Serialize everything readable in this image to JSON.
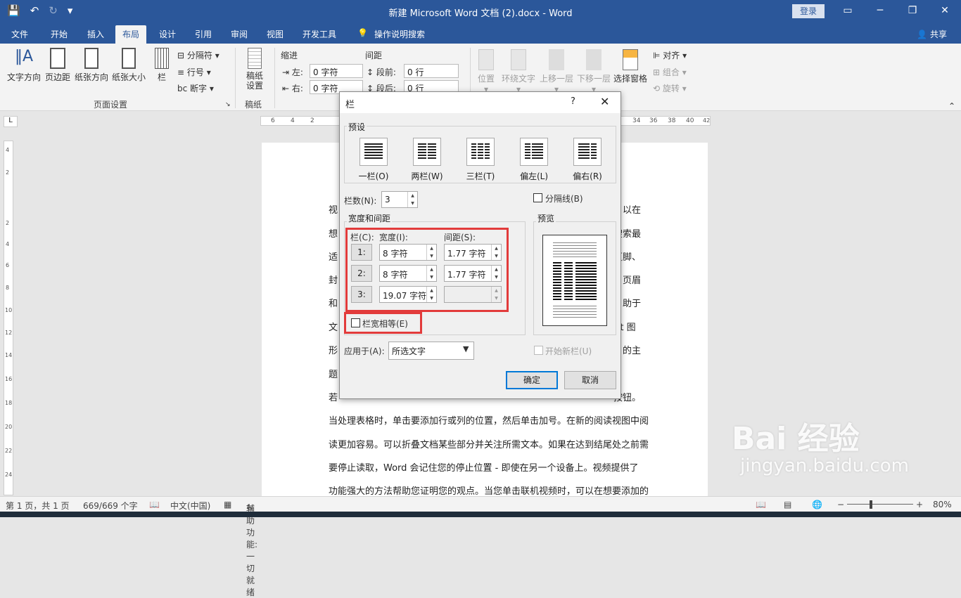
{
  "window": {
    "title": "新建 Microsoft Word 文档 (2).docx  -  Word",
    "login": "登录",
    "qat": {
      "save_icon": "save-icon",
      "undo_icon": "undo-icon",
      "redo_icon": "redo-icon"
    }
  },
  "tabs": [
    "文件",
    "开始",
    "插入",
    "布局",
    "设计",
    "引用",
    "审阅",
    "视图",
    "开发工具",
    "操作说明搜索"
  ],
  "share": "共享",
  "ribbon": {
    "text_direction": "文字方向",
    "margins": "页边距",
    "orientation": "纸张方向",
    "size": "纸张大小",
    "columns": "栏",
    "breaks": "分隔符",
    "line_numbers": "行号",
    "hyphenation": "断字",
    "page_setup": "页面设置",
    "manuscript_settings": "稿纸\n设置",
    "manuscript": "稿纸",
    "indent": "缩进",
    "spacing": "间距",
    "left": "左:",
    "right": "右:",
    "before": "段前:",
    "after": "段后:",
    "left_val": "0 字符",
    "right_val": "0 字符",
    "before_val": "0 行",
    "after_val": "0 行",
    "position": "位置",
    "wrap": "环绕文字",
    "forward": "上移一层",
    "backward": "下移一层",
    "selection_pane": "选择窗格",
    "align": "对齐",
    "group": "组合",
    "rotate": "旋转"
  },
  "ruler_h": [
    "6",
    "4",
    "2",
    "",
    "2",
    "34",
    "36",
    "38",
    "40",
    "42"
  ],
  "ruler_v": [
    "4",
    "2",
    "",
    "2",
    "4",
    "6",
    "8",
    "10",
    "12",
    "14",
    "16",
    "18",
    "20",
    "22",
    "24"
  ],
  "doc": {
    "left_chars": [
      "视",
      "想",
      "适",
      "封",
      "和",
      "文",
      "形",
      "题"
    ],
    "right_chars": [
      "以在",
      "搜索最",
      "页脚、",
      "页眉",
      "助于",
      "rt 图",
      "的主"
    ],
    "line_partial": "若",
    "line_partial_right": "按钮。",
    "lines": [
      "当处理表格时，单击要添加行或列的位置，然后单击加号。在新的阅读视图中阅",
      "读更加容易。可以折叠文档某些部分并关注所需文本。如果在达到结尾处之前需",
      "要停止读取，Word 会记住您的停止位置 - 即使在另一个设备上。视频提供了",
      "功能强大的方法帮助您证明您的观点。当您单击联机视频时，可以在想要添加的"
    ]
  },
  "dialog": {
    "title": "栏",
    "help": "?",
    "presets_label": "预设",
    "presets": [
      "一栏(O)",
      "两栏(W)",
      "三栏(T)",
      "偏左(L)",
      "偏右(R)"
    ],
    "num_cols_label": "栏数(N):",
    "num_cols": "3",
    "line_between": "分隔线(B)",
    "width_spacing": "宽度和间距",
    "preview": "预览",
    "col_hdr": "栏(C):",
    "width_hdr": "宽度(I):",
    "spacing_hdr": "间距(S):",
    "rows": [
      {
        "num": "1:",
        "width": "8 字符",
        "spacing": "1.77 字符"
      },
      {
        "num": "2:",
        "width": "8 字符",
        "spacing": "1.77 字符"
      },
      {
        "num": "3:",
        "width": "19.07 字符",
        "spacing": ""
      }
    ],
    "equal_width": "栏宽相等(E)",
    "apply_to_label": "应用于(A):",
    "apply_to": "所选文字",
    "new_column": "开始新栏(U)",
    "ok": "确定",
    "cancel": "取消"
  },
  "status": {
    "page": "第 1 页，共 1 页",
    "words": "669/669 个字",
    "lang": "中文(中国)",
    "accessibility": "辅助功能: 一切就绪",
    "zoom": "80%"
  },
  "watermark": {
    "logo": "Bai 经验",
    "url": "jingyan.baidu.com"
  }
}
